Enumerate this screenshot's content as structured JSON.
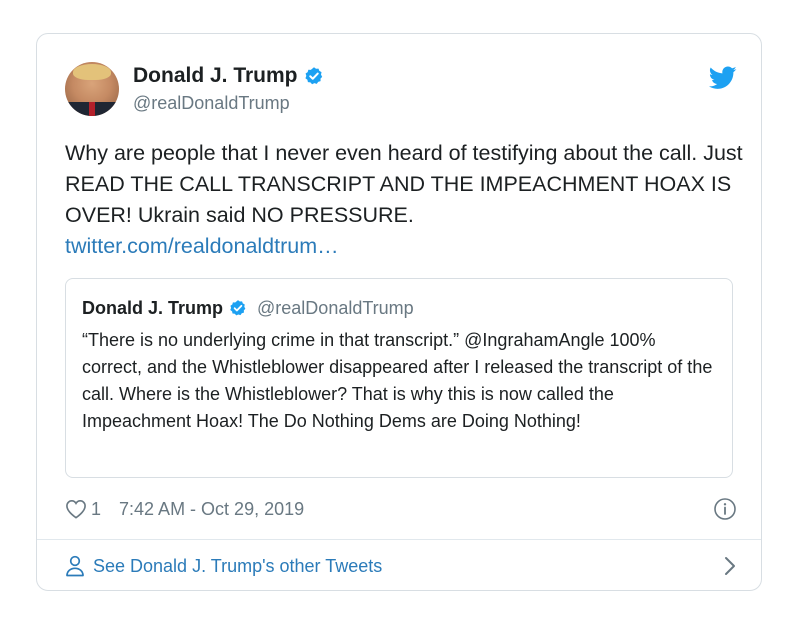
{
  "author": {
    "display_name": "Donald J. Trump",
    "handle": "@realDonaldTrump"
  },
  "tweet": {
    "text": "Why are people that I never even heard of testifying about the call. Just READ THE CALL TRANSCRIPT AND THE IMPEACHMENT HOAX IS OVER! Ukrain said NO PRESSURE.",
    "link": "twitter.com/realdonaldtrum…",
    "like_count": "1",
    "timestamp": "7:42 AM - Oct 29, 2019"
  },
  "quoted_tweet": {
    "display_name": "Donald J. Trump",
    "handle": "@realDonaldTrump",
    "text": "“There is no underlying crime in that transcript.” @IngrahamAngle 100% correct, and the Whistleblower disappeared after I released the transcript of the call. Where is the Whistleblower? That is why this is now called the Impeachment Hoax! The Do Nothing Dems are Doing Nothing!"
  },
  "footer": {
    "label": "See Donald J. Trump's other Tweets"
  },
  "icons": {
    "verified": "verified-badge-icon",
    "brand": "twitter-bird-icon",
    "like": "heart-icon",
    "info": "info-icon",
    "profile": "person-icon",
    "chevron": "chevron-right-icon"
  },
  "colors": {
    "brand_blue": "#1da1f2",
    "link_blue": "#2b7bb9",
    "text": "#1c2022",
    "secondary_text": "#697882",
    "border": "#d8dee3"
  }
}
